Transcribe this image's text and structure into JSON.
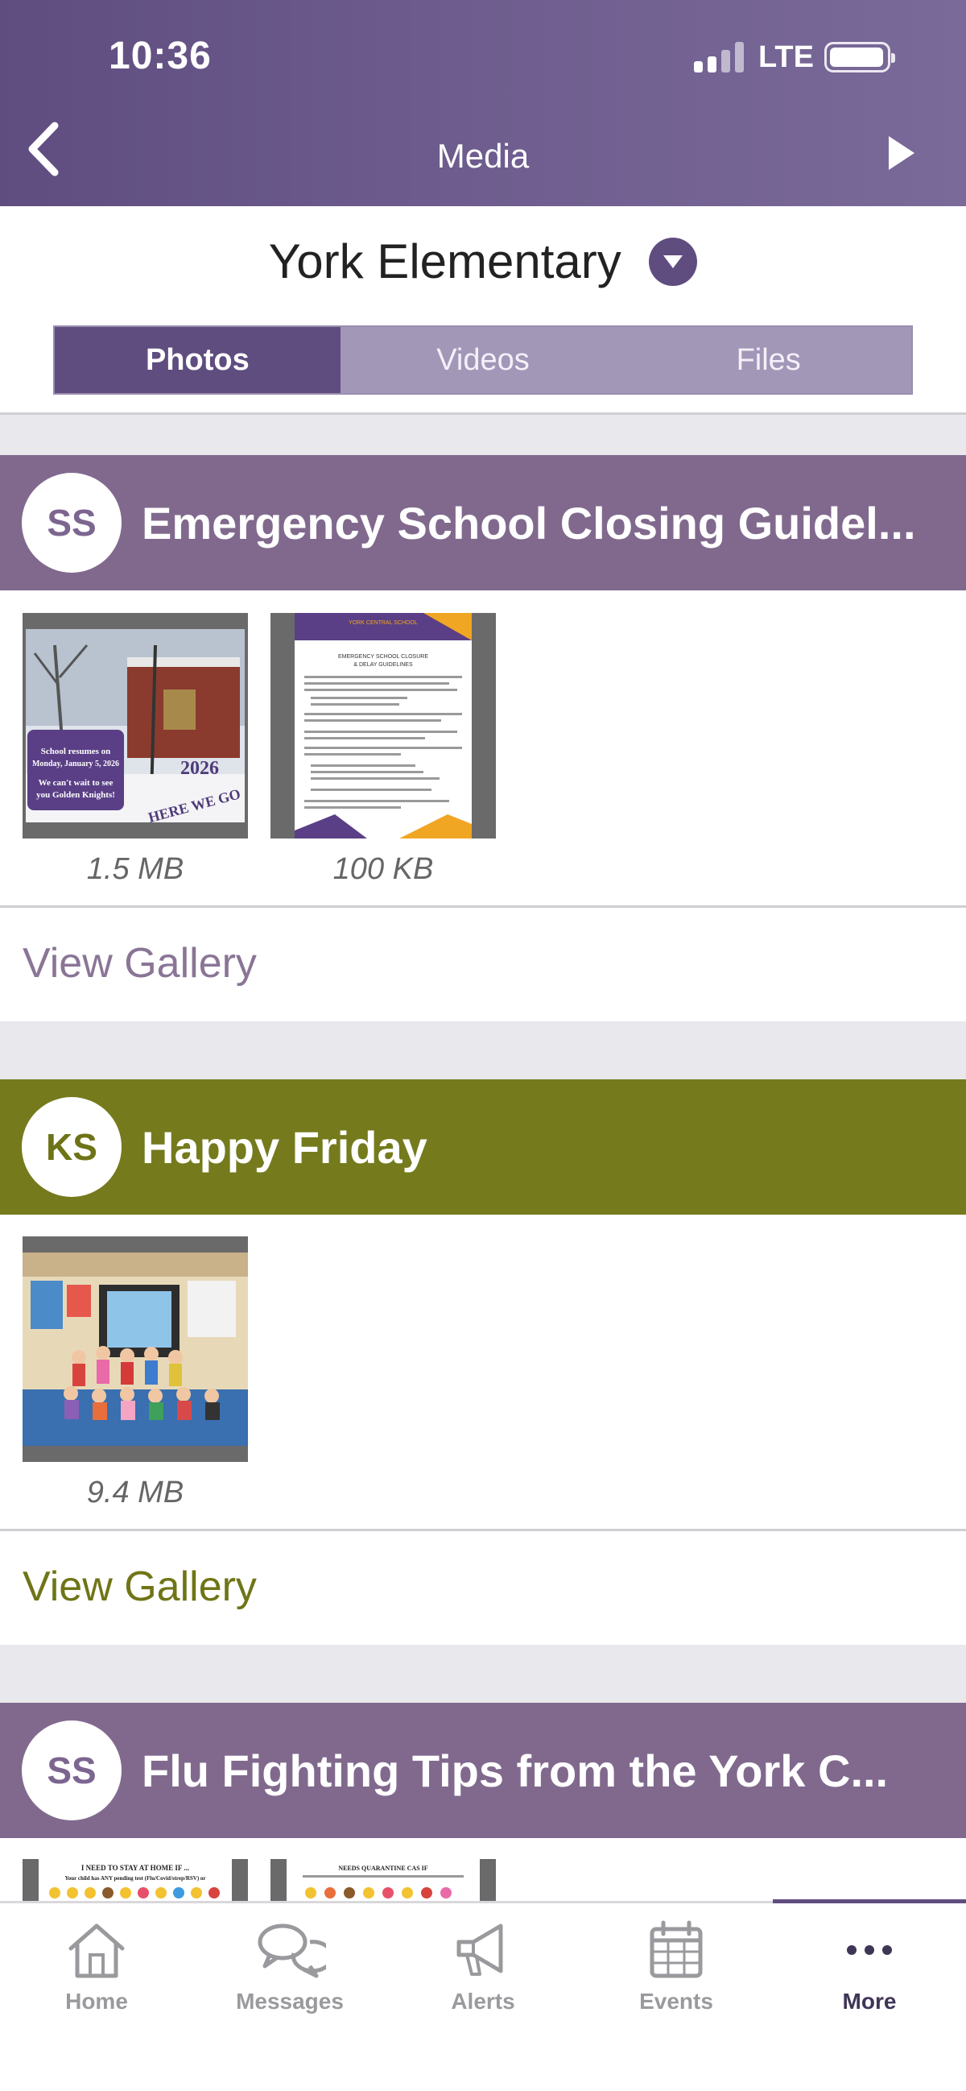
{
  "status_bar": {
    "time": "10:36",
    "network": "LTE"
  },
  "header": {
    "title": "Media"
  },
  "school_selector": {
    "name": "York Elementary"
  },
  "tabs": [
    {
      "label": "Photos",
      "active": true
    },
    {
      "label": "Videos",
      "active": false
    },
    {
      "label": "Files",
      "active": false
    }
  ],
  "posts": [
    {
      "initials": "SS",
      "title": "Emergency School Closing Guidel...",
      "color": "#81698e",
      "attachments": [
        {
          "size": "1.5 MB",
          "thumb_text": [
            "School resumes on Monday, January 5, 2026",
            "We can't wait to see you Golden Knights!",
            "2026",
            "HERE WE GO"
          ]
        },
        {
          "size": "100 KB",
          "thumb_text": [
            "YORK CENTRAL SCHOOL",
            "EMERGENCY SCHOOL CLOSURE & DELAY GUIDELINES"
          ]
        }
      ],
      "view_gallery": "View Gallery"
    },
    {
      "initials": "KS",
      "title": "Happy Friday",
      "color": "#757b1d",
      "attachments": [
        {
          "size": "9.4 MB"
        }
      ],
      "view_gallery": "View Gallery"
    },
    {
      "initials": "SS",
      "title": "Flu Fighting Tips from the York C...",
      "color": "#81698e",
      "attachments": [
        {
          "thumb_text": [
            "I NEED TO STAY AT HOME IF ...",
            "Your child has ANY pending test (Flu/Covid/strep/RSV) or"
          ]
        },
        {
          "thumb_text": [
            "NEEDS QUARANTINE CAS IF"
          ]
        }
      ]
    }
  ],
  "bottom_nav": [
    {
      "label": "Home",
      "icon": "home-icon"
    },
    {
      "label": "Messages",
      "icon": "messages-icon"
    },
    {
      "label": "Alerts",
      "icon": "megaphone-icon"
    },
    {
      "label": "Events",
      "icon": "calendar-icon"
    },
    {
      "label": "More",
      "icon": "more-icon",
      "active": true
    }
  ]
}
